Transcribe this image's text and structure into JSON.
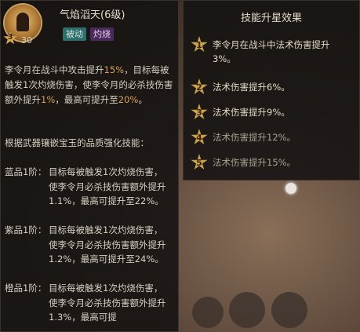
{
  "skill": {
    "name": "气焰滔天",
    "level": "(6级)",
    "star_level": "3",
    "skill_level_count": "30",
    "tags": [
      "被动",
      "灼烧"
    ],
    "icon": "flame-figure-icon"
  },
  "description": {
    "main_before": "李令月在战斗中攻击提升",
    "main_pct": "15%",
    "main_after": "，目标每被触发1次灼烧伤害，使李令月的必杀技伤害额外提升",
    "main_pct2": "1%",
    "main_after2": "，最高可提升至",
    "main_pct3": "20%",
    "main_end": "。",
    "intro": "根据武器镶嵌宝玉的品质强化技能："
  },
  "tiers": [
    {
      "label": "蓝品1阶：",
      "body": "目标每被触发1次灼烧伤害，使李令月必杀技伤害额外提升1.1%，最高可提升至22%。"
    },
    {
      "label": "紫品1阶：",
      "body": "目标每被触发1次灼烧伤害，使李令月必杀技伤害额外提升1.2%，最高可提升至24%。"
    },
    {
      "label": "橙品1阶：",
      "body": "目标每被触发1次灼烧伤害，使李令月必杀技伤害额外提升1.3%，最高可提"
    }
  ],
  "star_effects": {
    "title": "技能升星效果",
    "items": [
      {
        "star": "1",
        "text": "李令月在战斗中法术伤害提升3%。",
        "active": true
      },
      {
        "star": "2",
        "text": "法术伤害提升6%。",
        "active": true
      },
      {
        "star": "3",
        "text": "法术伤害提升9%。",
        "active": true
      },
      {
        "star": "4",
        "text": "法术伤害提升12%。",
        "active": false
      },
      {
        "star": "5",
        "text": "法术伤害提升15%。",
        "active": false
      }
    ]
  },
  "colors": {
    "highlight": "#d9a05a",
    "tag_passive": "#2f6e6a",
    "tag_burn": "#4a2a5a",
    "star_gold": "#c9a24a"
  }
}
